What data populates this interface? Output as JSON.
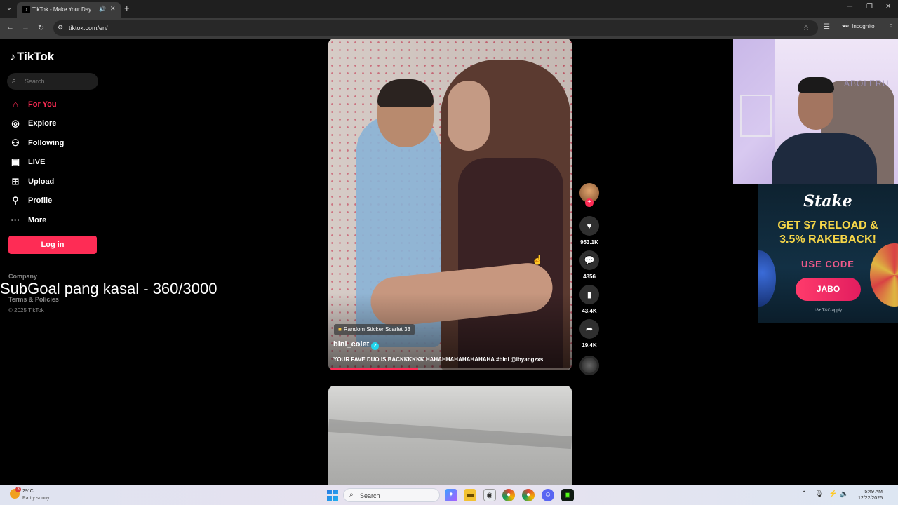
{
  "browser": {
    "tab_title": "TikTok - Make Your Day",
    "url": "tiktok.com/en/",
    "incognito_label": "Incognito"
  },
  "sidebar": {
    "logo": "TikTok",
    "search_placeholder": "Search",
    "items": [
      {
        "label": "For You",
        "icon": "home-icon",
        "active": true
      },
      {
        "label": "Explore",
        "icon": "compass-icon",
        "active": false
      },
      {
        "label": "Following",
        "icon": "following-icon",
        "active": false
      },
      {
        "label": "LIVE",
        "icon": "live-icon",
        "active": false
      },
      {
        "label": "Upload",
        "icon": "upload-icon",
        "active": false
      },
      {
        "label": "Profile",
        "icon": "profile-icon",
        "active": false
      },
      {
        "label": "More",
        "icon": "more-icon",
        "active": false
      }
    ],
    "login_label": "Log in",
    "footer": {
      "company": "Company",
      "terms": "Terms & Policies",
      "copyright": "© 2025 TikTok"
    }
  },
  "overlay_text": "SubGoal pang kasal - 360/3000",
  "video": {
    "sticker_tag": "Random Sticker Scarlet 33",
    "author": "bini_colet",
    "caption": "YOUR FAVE DUO IS BACKKKKKK HAHAHHAHAHAHAHAHA #bini @ibyangzxs",
    "progress": 0.37
  },
  "actions": {
    "likes": "953.1K",
    "comments": "4856",
    "saves": "43.4K",
    "shares": "19.4K"
  },
  "webcam": {
    "sign_text": "ABOLERU"
  },
  "ad": {
    "brand": "Stake",
    "headline_1": "GET $7 RELOAD &",
    "headline_2": "3.5% RAKEBACK!",
    "use_code": "USE CODE",
    "code": "JABO",
    "terms": "18+  T&C apply"
  },
  "taskbar": {
    "weather_badge": "3",
    "temperature": "29°C",
    "condition": "Partly sunny",
    "search_placeholder": "Search",
    "time": "5:49 AM",
    "date": "12/22/2025"
  }
}
